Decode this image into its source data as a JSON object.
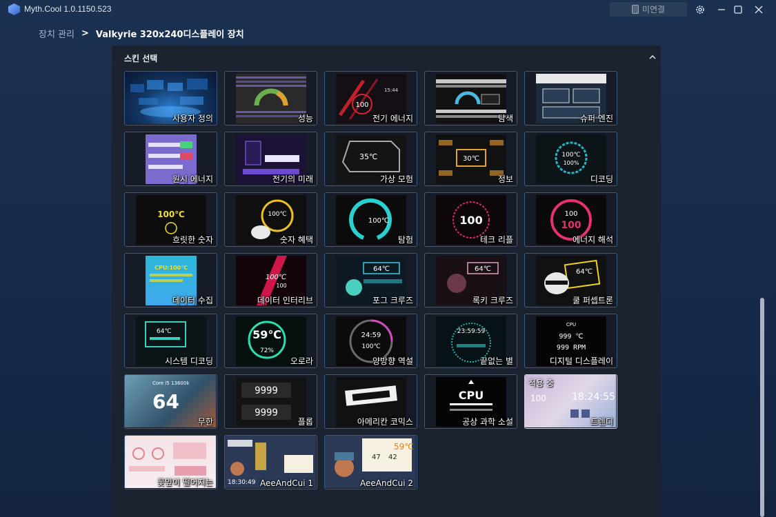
{
  "app": {
    "title": "Myth.Cool  1.0.1150.523"
  },
  "titlebar": {
    "connection_label": "미연결",
    "icons": [
      "device-icon",
      "gear-icon",
      "minimize-icon",
      "maximize-icon",
      "close-icon"
    ]
  },
  "breadcrumb": {
    "parent": "장치 관리",
    "separator": ">",
    "current": "Valkyrie 320x240디스플레이 장치"
  },
  "panel": {
    "title": "스킨 선택",
    "collapse_icon": "chevron-up-icon"
  },
  "skins": [
    {
      "label": "사용자 정의",
      "thumb": "t-custom"
    },
    {
      "label": "성능",
      "thumb": "t-perf"
    },
    {
      "label": "전기 에너지",
      "thumb": "t-elec"
    },
    {
      "label": "탐색",
      "thumb": "t-explore"
    },
    {
      "label": "슈퍼 엔진",
      "thumb": "t-super"
    },
    {
      "label": "원시 에너지",
      "thumb": "t-origin"
    },
    {
      "label": "전기의 미래",
      "thumb": "t-future"
    },
    {
      "label": "가상 모험",
      "thumb": "t-virtual"
    },
    {
      "label": "정보",
      "thumb": "t-info"
    },
    {
      "label": "디코딩",
      "thumb": "t-decode"
    },
    {
      "label": "흐릿한 숫자",
      "thumb": "t-blur"
    },
    {
      "label": "숫자 혜택",
      "thumb": "t-number"
    },
    {
      "label": "탐험",
      "thumb": "t-exp"
    },
    {
      "label": "테크 리플",
      "thumb": "t-tech"
    },
    {
      "label": "에너지 해석",
      "thumb": "t-energy"
    },
    {
      "label": "데이터 수집",
      "thumb": "t-datac"
    },
    {
      "label": "데이터 인터리브",
      "thumb": "t-datai"
    },
    {
      "label": "포그 크루즈",
      "thumb": "t-fog"
    },
    {
      "label": "록키 크루즈",
      "thumb": "t-roki"
    },
    {
      "label": "쿨 퍼셉트론",
      "thumb": "t-cool"
    },
    {
      "label": "시스템 디코딩",
      "thumb": "t-sysdec"
    },
    {
      "label": "오로라",
      "thumb": "t-aurora"
    },
    {
      "label": "양방향 역설",
      "thumb": "t-yin"
    },
    {
      "label": "끝없는 별",
      "thumb": "t-stars"
    },
    {
      "label": "디지털 디스플레이",
      "thumb": "t-digital"
    },
    {
      "label": "무한",
      "thumb": "t-inf"
    },
    {
      "label": "플롭",
      "thumb": "t-flip"
    },
    {
      "label": "아메리칸 코믹스",
      "thumb": "t-comic"
    },
    {
      "label": "공상 과학 소설",
      "thumb": "t-scifi"
    },
    {
      "label": "트렌디",
      "thumb": "t-trend",
      "selected": true,
      "badge": "적용 중"
    },
    {
      "label": "꽃잎이 떨어지는",
      "thumb": "t-petal"
    },
    {
      "label": "AeeAndCui 1",
      "thumb": "t-aac"
    },
    {
      "label": "AeeAndCui 2",
      "thumb": "t-aac"
    }
  ],
  "thumb_text": {
    "perf": "",
    "elec_temp": "100",
    "elec_time": "15:44",
    "virtual_temp": "35℃",
    "info_temp": "30℃",
    "decode_temp": "100℃",
    "decode_pct": "100%",
    "blur_temp": "100℃",
    "number_temp": "100℃",
    "exp_temp": "100℃",
    "tech_temp": "100",
    "energy_a": "100",
    "energy_b": "100",
    "datac_a": "CPU:100℃",
    "datai_a": "100℃",
    "datai_b": "100",
    "fog_temp": "64℃",
    "roki_temp": "64℃",
    "cool_temp": "64℃",
    "sysdec_temp": "64℃",
    "aurora_temp": "59℃",
    "aurora_pct": "72%",
    "yin_time": "24:59",
    "yin_temp": "100℃",
    "stars_time": "23:59:59",
    "digital_cpu": "CPU",
    "digital_temp": "999 ℃",
    "digital_rpm": "999 RPM",
    "inf_model": "Core i5 13600k",
    "inf_temp": "64",
    "flip_a": "9999",
    "flip_b": "9999",
    "scifi_cpu": "CPU",
    "trend_temp": "100",
    "trend_time": "18:24:55",
    "aac1_time": "18:30:49",
    "aac2_temp": "59℃",
    "aac2_a": "47",
    "aac2_b": "42"
  },
  "colors": {
    "bg": "#1a3150",
    "panel": "#1b2230",
    "card_border": "#3a5c86",
    "card_selected_border": "#cfd8e6",
    "accent": "#45d2e8"
  },
  "scrollbar": {
    "position": "bottom"
  }
}
